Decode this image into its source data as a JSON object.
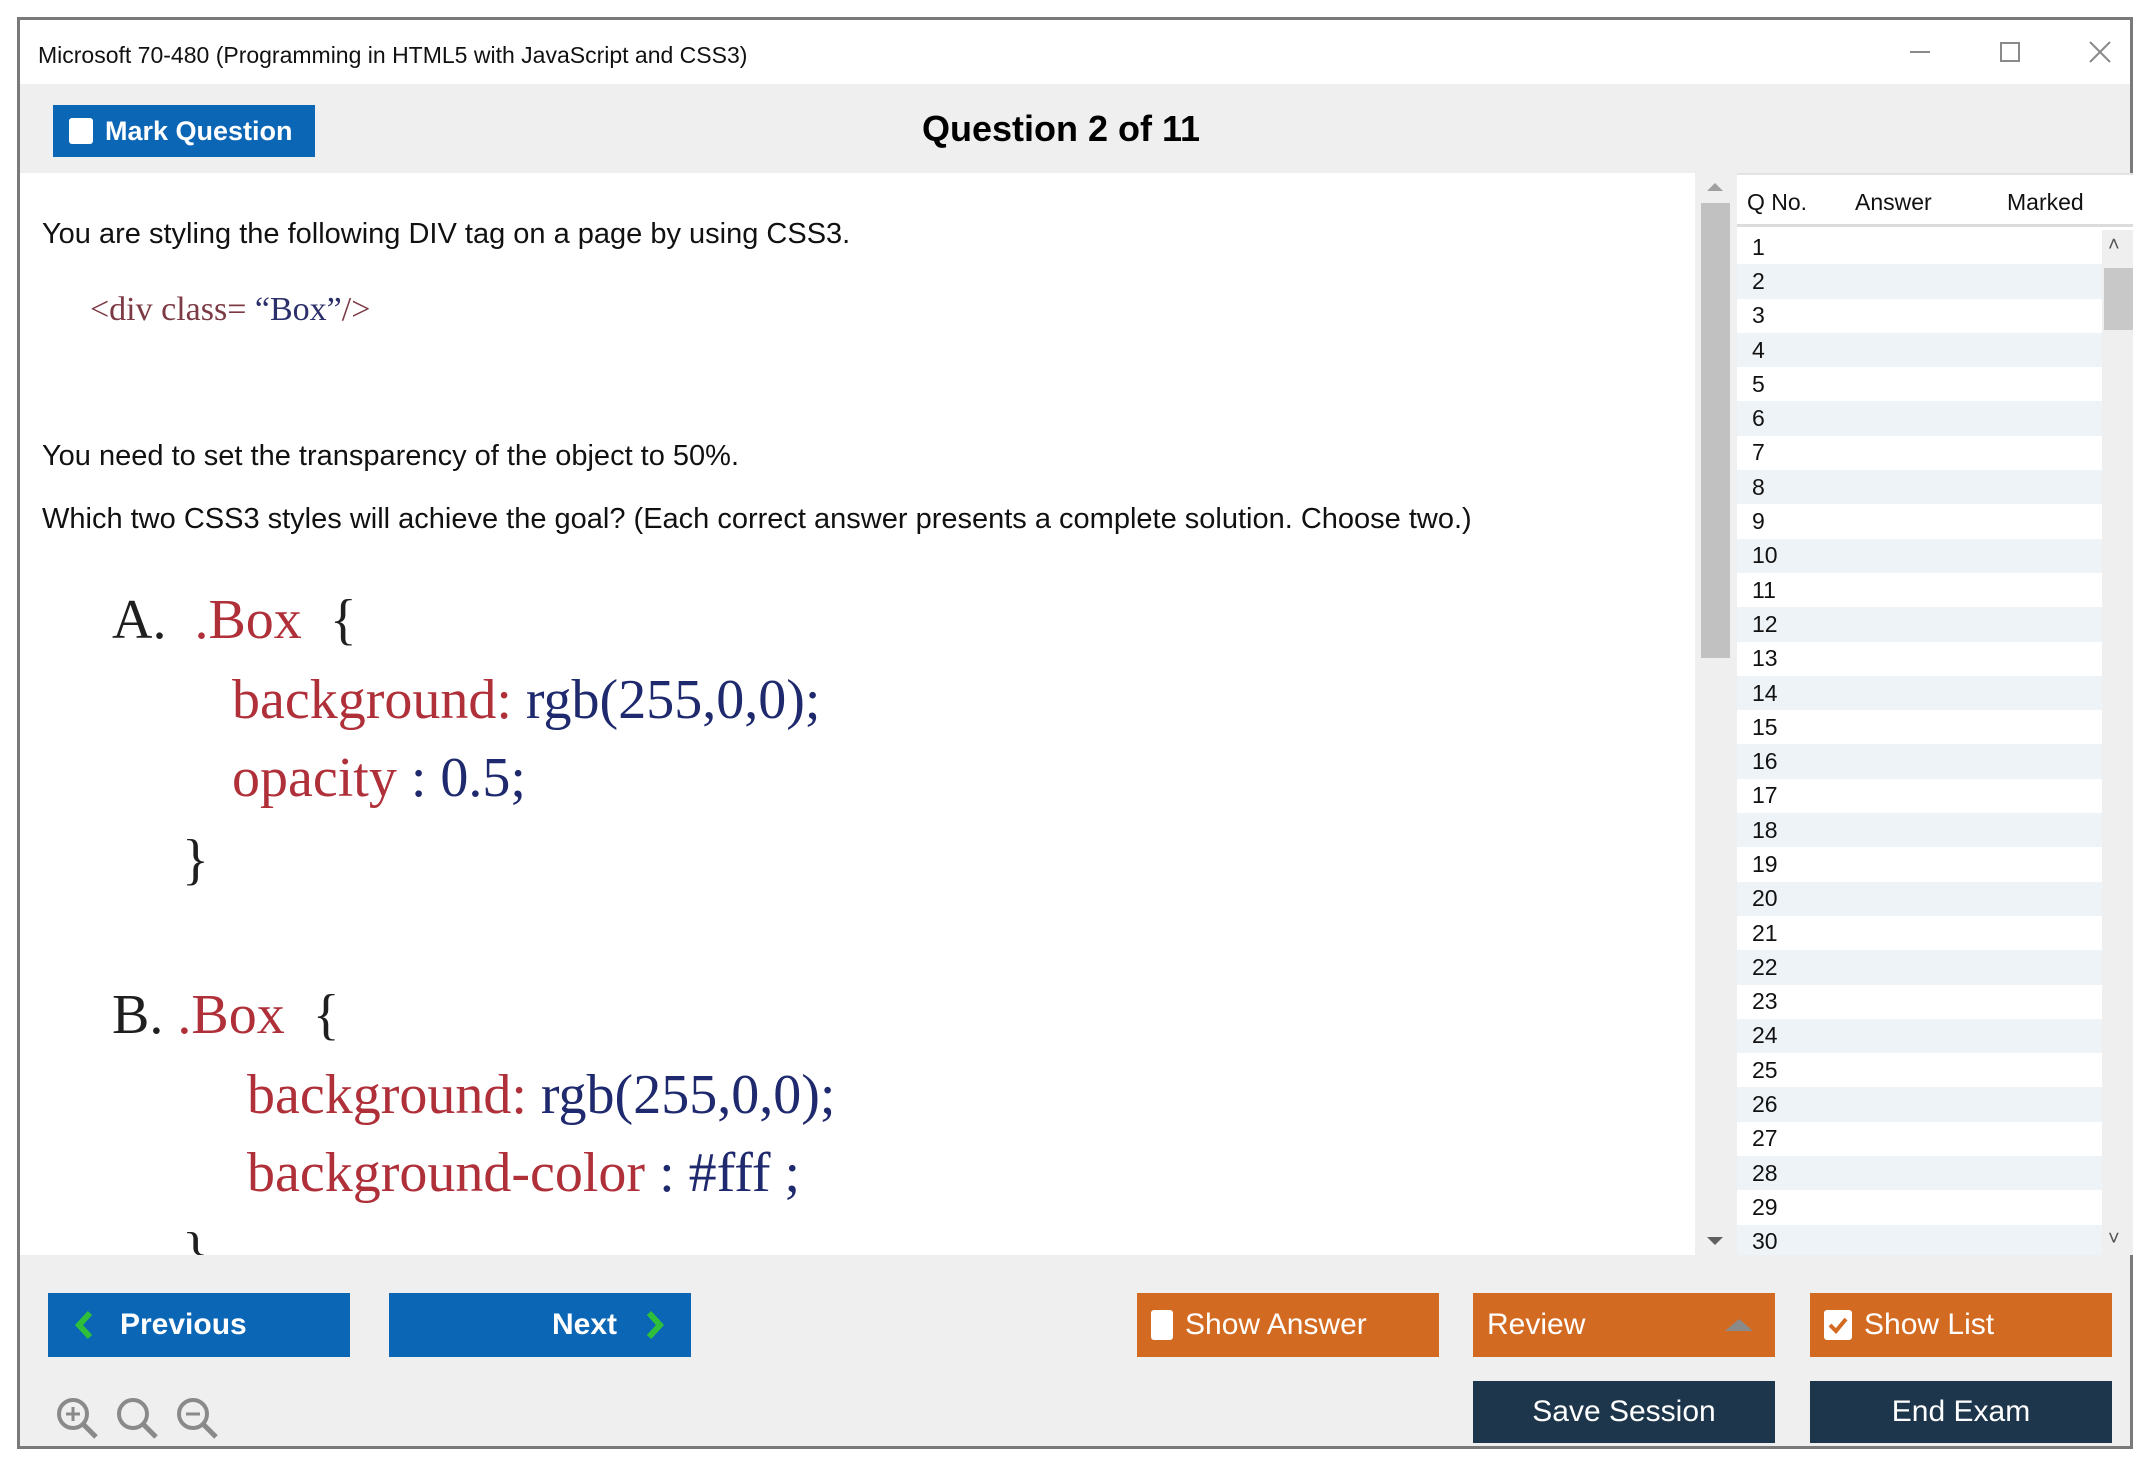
{
  "window": {
    "title": "Microsoft 70-480 (Programming in HTML5 with JavaScript and CSS3)",
    "controls": [
      "minimize-icon",
      "maximize-icon",
      "close-icon"
    ]
  },
  "header": {
    "mark_question_label": "Mark Question",
    "mark_question_checked": false,
    "question_counter": "Question 2 of 11"
  },
  "question": {
    "intro": "You are styling the following DIV tag on a page by using CSS3.",
    "code_snippet": {
      "open": "<div class= ",
      "value": "“Box”",
      "close": "/>"
    },
    "requirement": "You need to set the transparency of the object to 50%.",
    "prompt": "Which two CSS3 styles will achieve the goal? (Each correct answer presents a complete solution. Choose two.)",
    "options": [
      {
        "letter": "A.",
        "selector": ".Box",
        "open_brace": "{",
        "lines": [
          {
            "prop": "background:",
            "value": " rgb(255,0,0);"
          },
          {
            "prop": "opacity",
            "value": " : 0.5;"
          }
        ],
        "close_brace": "}"
      },
      {
        "letter": "B.",
        "selector": ".Box",
        "open_brace": "{",
        "lines": [
          {
            "prop": "background:",
            "value": " rgb(255,0,0);"
          },
          {
            "prop": "background-color",
            "value": " : #fff ;"
          }
        ],
        "close_brace": "}"
      }
    ]
  },
  "question_list": {
    "columns": [
      "Q No.",
      "Answer",
      "Marked"
    ],
    "rows": [
      "1",
      "2",
      "3",
      "4",
      "5",
      "6",
      "7",
      "8",
      "9",
      "10",
      "11",
      "12",
      "13",
      "14",
      "15",
      "16",
      "17",
      "18",
      "19",
      "20",
      "21",
      "22",
      "23",
      "24",
      "25",
      "26",
      "27",
      "28",
      "29",
      "30"
    ]
  },
  "footer": {
    "previous_label": "Previous",
    "next_label": "Next",
    "show_answer_label": "Show Answer",
    "show_answer_checked": false,
    "review_label": "Review",
    "show_list_label": "Show List",
    "show_list_checked": true,
    "save_session_label": "Save Session",
    "end_exam_label": "End Exam",
    "zoom_controls": [
      "zoom-in-icon",
      "zoom-reset-icon",
      "zoom-out-icon"
    ]
  },
  "colors": {
    "primary_blue": "#0b66b5",
    "accent_orange": "#d36a21",
    "navy": "#1d364b",
    "nav_arrow_green": "#2fbf3a"
  }
}
